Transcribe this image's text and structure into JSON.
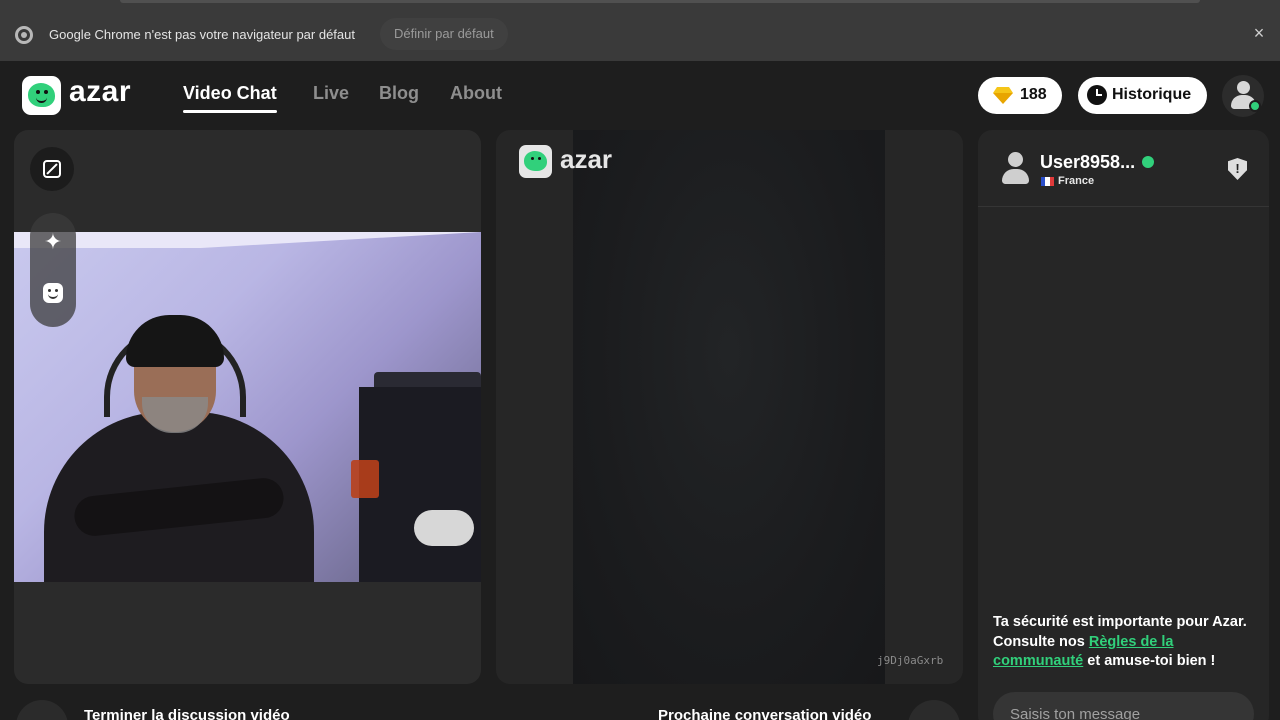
{
  "infobar": {
    "message": "Google Chrome n'est pas votre navigateur par défaut",
    "default_button": "Définir par défaut",
    "close_label": "×"
  },
  "header": {
    "brand": "azar",
    "nav": [
      {
        "label": "Video Chat",
        "active": true
      },
      {
        "label": "Live",
        "active": false
      },
      {
        "label": "Blog",
        "active": false
      },
      {
        "label": "About",
        "active": false
      }
    ],
    "gems": "188",
    "history_label": "Historique"
  },
  "middle": {
    "watermark": "azar",
    "code": "j9Dj0aGxrb"
  },
  "chat": {
    "partner_name": "User8958...",
    "country": "France",
    "safety_text_1": "Ta sécurité est importante pour Azar. Consulte nos ",
    "safety_link": "Règles de la communauté",
    "safety_text_2": " et amuse-toi bien !",
    "input_placeholder": "Saisis ton message"
  },
  "bottom": {
    "end_label": "Terminer la discussion vidéo",
    "next_label": "Prochaine conversation vidéo"
  },
  "colors": {
    "accent": "#31d07b",
    "background": "#1e1e1e",
    "panel": "#2b2b2b"
  }
}
